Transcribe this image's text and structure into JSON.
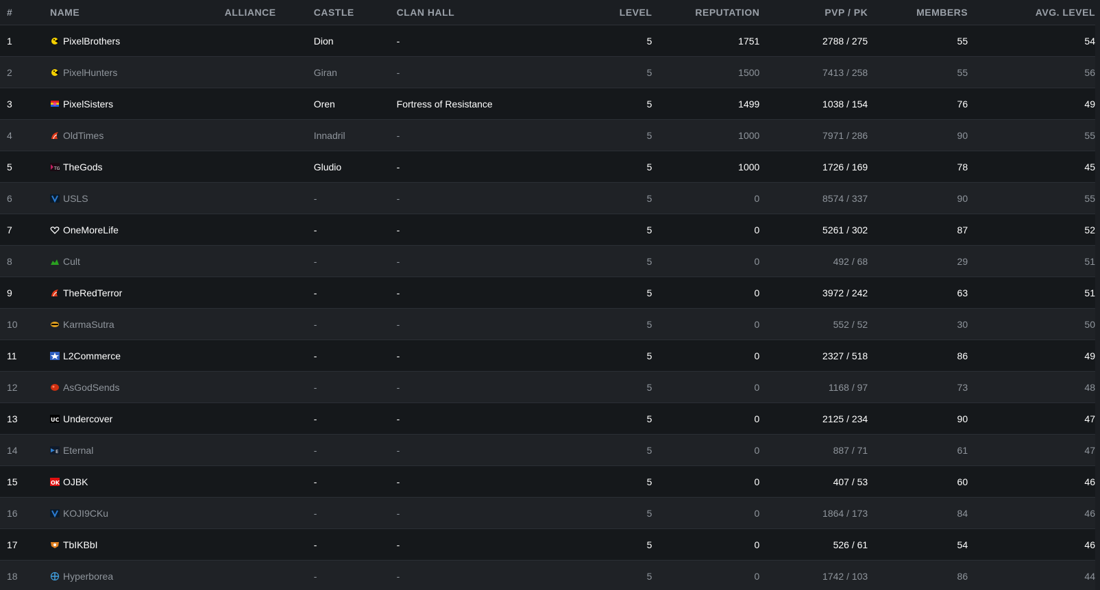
{
  "columns": {
    "rank": "#",
    "name": "NAME",
    "alliance": "ALLIANCE",
    "castle": "CASTLE",
    "clan_hall": "CLAN HALL",
    "level": "LEVEL",
    "reputation": "REPUTATION",
    "pvp_pk": "PVP / PK",
    "members": "MEMBERS",
    "avg_level": "AVG. LEVEL"
  },
  "rows": [
    {
      "rank": "1",
      "name": "PixelBrothers",
      "crest": "pacman-crest-icon",
      "crest_color": "#f5d000",
      "alliance": "",
      "castle": "Dion",
      "clan_hall": "-",
      "level": "5",
      "reputation": "1751",
      "pvp_pk": "2788 / 275",
      "members": "55",
      "avg_level": "54"
    },
    {
      "rank": "2",
      "name": "PixelHunters",
      "crest": "pacman-crest-icon",
      "crest_color": "#f5d000",
      "alliance": "",
      "castle": "Giran",
      "clan_hall": "-",
      "level": "5",
      "reputation": "1500",
      "pvp_pk": "7413 / 258",
      "members": "55",
      "avg_level": "56"
    },
    {
      "rank": "3",
      "name": "PixelSisters",
      "crest": "rainbow-crest-icon",
      "crest_color": "#e040a0",
      "alliance": "",
      "castle": "Oren",
      "clan_hall": "Fortress of Resistance",
      "level": "5",
      "reputation": "1499",
      "pvp_pk": "1038 / 154",
      "members": "76",
      "avg_level": "49"
    },
    {
      "rank": "4",
      "name": "OldTimes",
      "crest": "flame-crest-icon",
      "crest_color": "#e03a1a",
      "alliance": "",
      "castle": "Innadril",
      "clan_hall": "-",
      "level": "5",
      "reputation": "1000",
      "pvp_pk": "7971 / 286",
      "members": "90",
      "avg_level": "55"
    },
    {
      "rank": "5",
      "name": "TheGods",
      "crest": "tg-crest-icon",
      "crest_color": "#c02060",
      "alliance": "",
      "castle": "Gludio",
      "clan_hall": "-",
      "level": "5",
      "reputation": "1000",
      "pvp_pk": "1726 / 169",
      "members": "78",
      "avg_level": "45"
    },
    {
      "rank": "6",
      "name": "USLS",
      "crest": "v-crest-icon",
      "crest_color": "#2a7ad0",
      "alliance": "",
      "castle": "-",
      "clan_hall": "-",
      "level": "5",
      "reputation": "0",
      "pvp_pk": "8574 / 337",
      "members": "90",
      "avg_level": "55"
    },
    {
      "rank": "7",
      "name": "OneMoreLife",
      "crest": "heart-crest-icon",
      "crest_color": "#ffffff",
      "alliance": "",
      "castle": "-",
      "clan_hall": "-",
      "level": "5",
      "reputation": "0",
      "pvp_pk": "5261 / 302",
      "members": "87",
      "avg_level": "52"
    },
    {
      "rank": "8",
      "name": "Cult",
      "crest": "dragon-crest-icon",
      "crest_color": "#2aa020",
      "alliance": "",
      "castle": "-",
      "clan_hall": "-",
      "level": "5",
      "reputation": "0",
      "pvp_pk": "492 / 68",
      "members": "29",
      "avg_level": "51"
    },
    {
      "rank": "9",
      "name": "TheRedTerror",
      "crest": "flame-crest-icon",
      "crest_color": "#e03a1a",
      "alliance": "",
      "castle": "-",
      "clan_hall": "-",
      "level": "5",
      "reputation": "0",
      "pvp_pk": "3972 / 242",
      "members": "63",
      "avg_level": "51"
    },
    {
      "rank": "10",
      "name": "KarmaSutra",
      "crest": "mask-crest-icon",
      "crest_color": "#e0a020",
      "alliance": "",
      "castle": "-",
      "clan_hall": "-",
      "level": "5",
      "reputation": "0",
      "pvp_pk": "552 / 52",
      "members": "30",
      "avg_level": "50"
    },
    {
      "rank": "11",
      "name": "L2Commerce",
      "crest": "star-crest-icon",
      "crest_color": "#3060c0",
      "alliance": "",
      "castle": "-",
      "clan_hall": "-",
      "level": "5",
      "reputation": "0",
      "pvp_pk": "2327 / 518",
      "members": "86",
      "avg_level": "49"
    },
    {
      "rank": "12",
      "name": "AsGodSends",
      "crest": "blob-crest-icon",
      "crest_color": "#d03010",
      "alliance": "",
      "castle": "-",
      "clan_hall": "-",
      "level": "5",
      "reputation": "0",
      "pvp_pk": "1168 / 97",
      "members": "73",
      "avg_level": "48"
    },
    {
      "rank": "13",
      "name": "Undercover",
      "crest": "uc-crest-icon",
      "crest_color": "#ffffff",
      "alliance": "",
      "castle": "-",
      "clan_hall": "-",
      "level": "5",
      "reputation": "0",
      "pvp_pk": "2125 / 234",
      "members": "90",
      "avg_level": "47"
    },
    {
      "rank": "14",
      "name": "Eternal",
      "crest": "wing-crest-icon",
      "crest_color": "#3080d0",
      "alliance": "",
      "castle": "-",
      "clan_hall": "-",
      "level": "5",
      "reputation": "0",
      "pvp_pk": "887 / 71",
      "members": "61",
      "avg_level": "47"
    },
    {
      "rank": "15",
      "name": "OJBK",
      "crest": "ok-crest-icon",
      "crest_color": "#e01010",
      "alliance": "",
      "castle": "-",
      "clan_hall": "-",
      "level": "5",
      "reputation": "0",
      "pvp_pk": "407 / 53",
      "members": "60",
      "avg_level": "46"
    },
    {
      "rank": "16",
      "name": "KOJI9CKu",
      "crest": "v-crest-icon",
      "crest_color": "#2a7ad0",
      "alliance": "",
      "castle": "-",
      "clan_hall": "-",
      "level": "5",
      "reputation": "0",
      "pvp_pk": "1864 / 173",
      "members": "84",
      "avg_level": "46"
    },
    {
      "rank": "17",
      "name": "TbIKBbI",
      "crest": "shield-crest-icon",
      "crest_color": "#e08020",
      "alliance": "",
      "castle": "-",
      "clan_hall": "-",
      "level": "5",
      "reputation": "0",
      "pvp_pk": "526 / 61",
      "members": "54",
      "avg_level": "46"
    },
    {
      "rank": "18",
      "name": "Hyperborea",
      "crest": "cross-crest-icon",
      "crest_color": "#40a0e0",
      "alliance": "",
      "castle": "-",
      "clan_hall": "-",
      "level": "5",
      "reputation": "0",
      "pvp_pk": "1742 / 103",
      "members": "86",
      "avg_level": "44"
    }
  ]
}
